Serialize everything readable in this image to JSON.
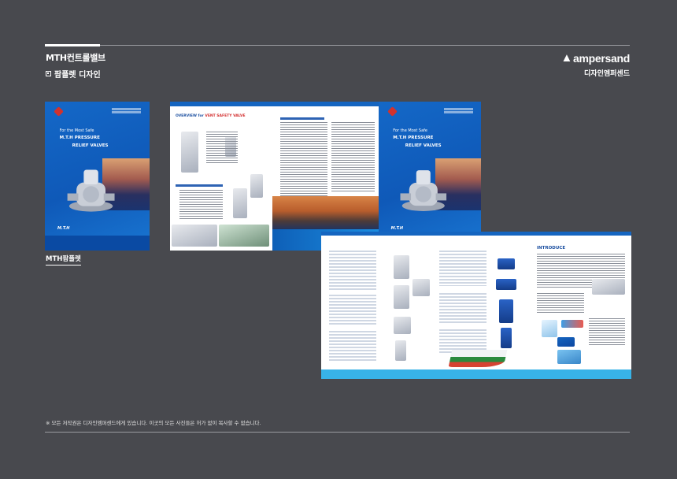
{
  "header": {
    "title": "MTH컨트롤밸브",
    "subtitle": "팜플렛 디자인"
  },
  "brand": {
    "logo_text": "ampersand",
    "sub": "디자인엠퍼센드"
  },
  "cover": {
    "line1": "For the Most Safe",
    "line2": "M.T.H PRESSURE",
    "line3": "RELIEF VALVES",
    "maker": "M.T.H"
  },
  "spread1": {
    "heading_a": "OVERVIEW for",
    "heading_b": "VENT SAFETY VALVE"
  },
  "spread2": {
    "heading": "INTRODUCE"
  },
  "caption": "MTH팜플렛",
  "footer": "※ 모든 저작권은 디자인엠퍼센드에게 있습니다. 이곳의 모든 사진들은 허가 없이 복사할 수 없습니다.",
  "colors": {
    "background": "#48494e",
    "brochure_blue": "#1565c0",
    "accent_red": "#d32f2f"
  }
}
